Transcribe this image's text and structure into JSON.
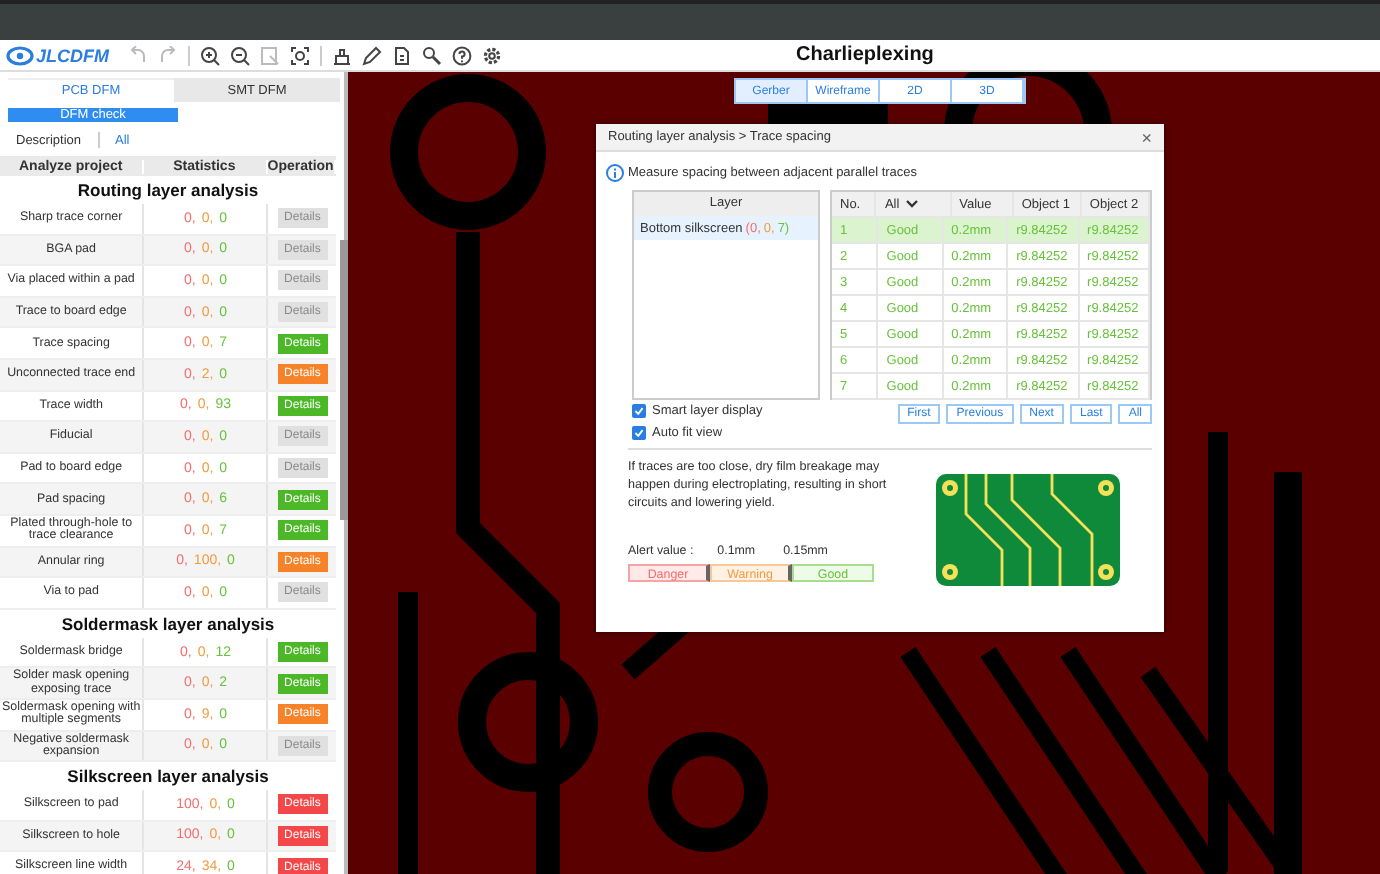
{
  "app": {
    "logo": "JLCDFM",
    "title": "Charlieplexing"
  },
  "side_tabs": [
    {
      "label": "PCB DFM",
      "selected": true
    },
    {
      "label": "SMT DFM",
      "selected": false
    }
  ],
  "check_button": "DFM check",
  "filter": {
    "label": "Description",
    "value": "All"
  },
  "columns": [
    "Analyze project",
    "Statistics",
    "Operation"
  ],
  "sections": [
    {
      "title": "Routing layer analysis",
      "rows": [
        {
          "name": "Sharp trace corner",
          "stats": [
            "0,",
            "0,",
            "0"
          ],
          "disabled": true,
          "action": "Details"
        },
        {
          "name": "BGA pad",
          "stats": [
            "0,",
            "0,",
            "0"
          ],
          "disabled": true,
          "action": "Details"
        },
        {
          "name": "Via placed within a pad",
          "stats": [
            "0,",
            "0,",
            "0"
          ],
          "disabled": true,
          "action": "Details"
        },
        {
          "name": "Trace to board edge",
          "stats": [
            "0,",
            "0,",
            "0"
          ],
          "disabled": true,
          "action": "Details"
        },
        {
          "name": "Trace spacing",
          "stats": [
            "0,",
            "0,",
            "7"
          ],
          "disabled": false,
          "color": "#4cb828",
          "action": "Details"
        },
        {
          "name": "Unconnected trace end",
          "stats": [
            "0,",
            "2,",
            "0"
          ],
          "disabled": false,
          "color": "#f6822a",
          "action": "Details"
        },
        {
          "name": "Trace width",
          "stats": [
            "0,",
            "0,",
            "93"
          ],
          "disabled": false,
          "color": "#4cb828",
          "action": "Details"
        },
        {
          "name": "Fiducial",
          "stats": [
            "0,",
            "0,",
            "0"
          ],
          "disabled": true,
          "action": "Details"
        },
        {
          "name": "Pad to board edge",
          "stats": [
            "0,",
            "0,",
            "0"
          ],
          "disabled": true,
          "action": "Details"
        },
        {
          "name": "Pad spacing",
          "stats": [
            "0,",
            "0,",
            "6"
          ],
          "disabled": false,
          "color": "#4cb828",
          "action": "Details"
        },
        {
          "name": "Plated through-hole to trace clearance",
          "stats": [
            "0,",
            "0,",
            "7"
          ],
          "disabled": false,
          "color": "#4cb828",
          "action": "Details"
        },
        {
          "name": "Annular ring",
          "stats": [
            "0,",
            "100,",
            "0"
          ],
          "disabled": false,
          "color": "#f6822a",
          "action": "Details"
        },
        {
          "name": "Via to pad",
          "stats": [
            "0,",
            "0,",
            "0"
          ],
          "disabled": true,
          "action": "Details"
        }
      ]
    },
    {
      "title": "Soldermask layer analysis",
      "rows": [
        {
          "name": "Soldermask bridge",
          "stats": [
            "0,",
            "0,",
            "12"
          ],
          "disabled": false,
          "color": "#4cb828",
          "action": "Details"
        },
        {
          "name": "Solder mask opening exposing trace",
          "stats": [
            "0,",
            "0,",
            "2"
          ],
          "disabled": false,
          "color": "#4cb828",
          "action": "Details"
        },
        {
          "name": "Soldermask opening with multiple segments",
          "stats": [
            "0,",
            "9,",
            "0"
          ],
          "disabled": false,
          "color": "#f6822a",
          "action": "Details"
        },
        {
          "name": "Negative soldermask expansion",
          "stats": [
            "0,",
            "0,",
            "0"
          ],
          "disabled": true,
          "action": "Details"
        }
      ]
    },
    {
      "title": "Silkscreen layer analysis",
      "rows": [
        {
          "name": "Silkscreen to pad",
          "stats": [
            "100,",
            "0,",
            "0"
          ],
          "disabled": false,
          "color": "#f4474a",
          "action": "Details"
        },
        {
          "name": "Silkscreen to hole",
          "stats": [
            "100,",
            "0,",
            "0"
          ],
          "disabled": false,
          "color": "#f4474a",
          "action": "Details"
        },
        {
          "name": "Silkscreen line width",
          "stats": [
            "24,",
            "34,",
            "0"
          ],
          "disabled": false,
          "color": "#f4474a",
          "action": "Details"
        }
      ]
    }
  ],
  "view_tabs": [
    {
      "label": "Gerber",
      "selected": true
    },
    {
      "label": "Wireframe",
      "selected": false
    },
    {
      "label": "2D",
      "selected": false
    },
    {
      "label": "3D",
      "selected": false
    }
  ],
  "dialog": {
    "title": "Routing layer analysis > Trace spacing",
    "close": "×",
    "info": "Measure spacing between adjacent parallel traces",
    "layer_header": "Layer",
    "layers": [
      {
        "name": "Bottom silkscreen",
        "counts": [
          "(0,",
          "0,",
          "7)"
        ],
        "selected": true
      }
    ],
    "columns": [
      "No.",
      "All",
      "Value",
      "Object 1",
      "Object 2"
    ],
    "rows": [
      {
        "no": "1",
        "status": "Good",
        "value": "0.2mm",
        "object_1": "r9.84252",
        "object_2": "r9.84252",
        "selected": true
      },
      {
        "no": "2",
        "status": "Good",
        "value": "0.2mm",
        "object_1": "r9.84252",
        "object_2": "r9.84252",
        "selected": false
      },
      {
        "no": "3",
        "status": "Good",
        "value": "0.2mm",
        "object_1": "r9.84252",
        "object_2": "r9.84252",
        "selected": false
      },
      {
        "no": "4",
        "status": "Good",
        "value": "0.2mm",
        "object_1": "r9.84252",
        "object_2": "r9.84252",
        "selected": false
      },
      {
        "no": "5",
        "status": "Good",
        "value": "0.2mm",
        "object_1": "r9.84252",
        "object_2": "r9.84252",
        "selected": false
      },
      {
        "no": "6",
        "status": "Good",
        "value": "0.2mm",
        "object_1": "r9.84252",
        "object_2": "r9.84252",
        "selected": false
      },
      {
        "no": "7",
        "status": "Good",
        "value": "0.2mm",
        "object_1": "r9.84252",
        "object_2": "r9.84252",
        "selected": false
      }
    ],
    "options": [
      {
        "label": "Smart layer display",
        "checked": true
      },
      {
        "label": "Auto fit view",
        "checked": true
      }
    ],
    "pager": [
      "First",
      "Previous",
      "Next",
      "Last",
      "All"
    ],
    "description": "If traces are too close, dry film breakage may happen during electroplating, resulting in short circuits and lowering yield.",
    "alert": {
      "label": "Alert value :",
      "thresholds": [
        "0.1mm",
        "0.15mm"
      ],
      "zones": [
        "Danger",
        "Warning",
        "Good"
      ]
    }
  }
}
